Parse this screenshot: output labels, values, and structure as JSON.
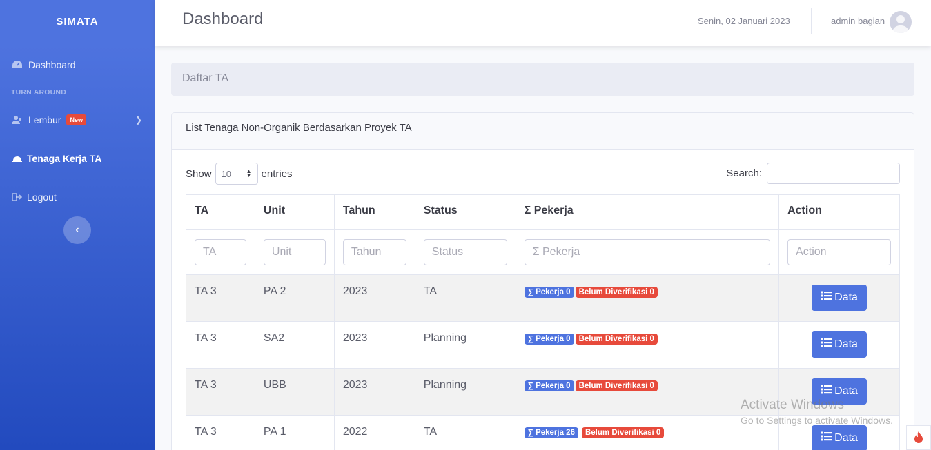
{
  "sidebar": {
    "brand": "SIMATA",
    "items": [
      {
        "label": "Dashboard",
        "icon": "tachometer-icon"
      },
      {
        "label": "Lembur",
        "icon": "users-icon",
        "badge": "New"
      },
      {
        "label": "Tenaga Kerja TA",
        "icon": "hard-hat-icon"
      },
      {
        "label": "Logout",
        "icon": "sign-out-icon"
      }
    ],
    "heading": "TURN AROUND",
    "toggle_icon": "chevron-left"
  },
  "topbar": {
    "title": "Dashboard",
    "date": "Senin, 02 Januari 2023",
    "user": "admin bagian"
  },
  "breadcrumb": "Daftar TA",
  "card": {
    "title": "List Tenaga Non-Organik Berdasarkan Proyek TA",
    "show_label": "Show",
    "entries_value": "10",
    "entries_label": "entries",
    "search_label": "Search:",
    "search_value": ""
  },
  "table": {
    "headers": [
      "TA",
      "Unit",
      "Tahun",
      "Status",
      "Σ Pekerja",
      "Action"
    ],
    "filters": [
      "TA",
      "Unit",
      "Tahun",
      "Status",
      "Σ Pekerja",
      "Action"
    ],
    "rows": [
      {
        "ta": "TA 3",
        "unit": "PA 2",
        "tahun": "2023",
        "status": "TA",
        "pekerja": "∑ Pekerja 0",
        "verif": "Belum Diverifikasi 0",
        "action": "Data"
      },
      {
        "ta": "TA 3",
        "unit": "SA2",
        "tahun": "2023",
        "status": "Planning",
        "pekerja": "∑ Pekerja 0",
        "verif": "Belum Diverifikasi 0",
        "action": "Data"
      },
      {
        "ta": "TA 3",
        "unit": "UBB",
        "tahun": "2023",
        "status": "Planning",
        "pekerja": "∑ Pekerja 0",
        "verif": "Belum Diverifikasi 0",
        "action": "Data"
      },
      {
        "ta": "TA 3",
        "unit": "PA 1",
        "tahun": "2022",
        "status": "TA",
        "pekerja": "∑ Pekerja 26",
        "verif": "Belum Diverifikasi 0",
        "action": "Data"
      }
    ]
  },
  "watermark": {
    "line1": "Activate Windows",
    "line2": "Go to Settings to activate Windows."
  },
  "colors": {
    "primary": "#4e73df",
    "danger": "#e74a3b"
  }
}
